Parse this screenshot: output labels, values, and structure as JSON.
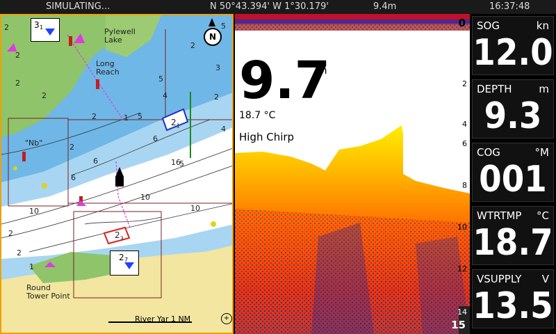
{
  "status": {
    "mode": "SIMULATING...",
    "position": "N  50°43.394' W   1°30.179'",
    "distance": "9.4m",
    "time": "16:37:48"
  },
  "chart": {
    "labels": {
      "pylewell_lake": "Pylewell\nLake",
      "long_reach": "Long\nReach",
      "nb": "\"Nb\"",
      "round_tower_point": "Round\nTower Point",
      "scale": "River Yar 1 NM"
    },
    "depths": [
      "2",
      "2",
      "2",
      "5",
      "3",
      "4",
      "2",
      "2",
      "1",
      "4",
      "5",
      "2",
      "6",
      "6",
      "16",
      "6",
      "10",
      "10",
      "2",
      "10",
      "2",
      "1",
      "2",
      "5",
      "2",
      "5"
    ],
    "waypoints": [
      {
        "name": "3",
        "sub": "1"
      },
      {
        "name": "2",
        "sub": "1"
      },
      {
        "name": "2",
        "sub": "3"
      },
      {
        "name": "2",
        "sub": "7"
      }
    ],
    "north_icon": "north-arrow-icon"
  },
  "sonar": {
    "depth": "9.7",
    "depth_unit": "m",
    "water_temp": "18.7 °C",
    "frequency": "High Chirp",
    "scale_top": "0",
    "scale_marks": [
      "2",
      "4",
      "6",
      "8",
      "10",
      "12",
      "14"
    ],
    "scale_bottom": "15",
    "colors": {
      "water": "#ffffff",
      "strong": "#ffee00",
      "mid": "#ff8a00",
      "deep": "#c0102a",
      "noise": "#3a2a8a"
    }
  },
  "instruments": [
    {
      "label": "SOG",
      "unit": "kn",
      "value": "12.0"
    },
    {
      "label": "DEPTH",
      "unit": "m",
      "value": "9.3"
    },
    {
      "label": "COG",
      "unit": "°M",
      "value": "001"
    },
    {
      "label": "WTRTMP",
      "unit": "°C",
      "value": "18.7"
    },
    {
      "label": "VSUPPLY",
      "unit": "V",
      "value": "13.5"
    }
  ]
}
